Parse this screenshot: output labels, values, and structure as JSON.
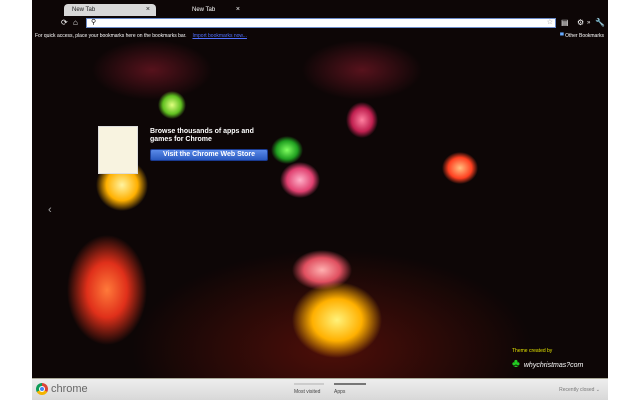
{
  "tabs": [
    {
      "label": "New Tab",
      "close": "×"
    },
    {
      "label": "New Tab",
      "close": "×"
    }
  ],
  "toolbar": {
    "search_value": "",
    "icons": [
      "reload-icon",
      "home-icon",
      "search-icon",
      "star-icon",
      "page-icon",
      "gear-icon",
      "wrench-icon"
    ]
  },
  "bookmarks": {
    "message": "For quick access, place your bookmarks here on the bookmarks bar.",
    "import_link": "Import bookmarks now...",
    "other": "Other Bookmarks"
  },
  "promo": {
    "text": "Browse thousands of apps and games for Chrome",
    "button": "Visit the Chrome Web Store"
  },
  "nav": {
    "prev": "‹"
  },
  "credit": {
    "label": "Theme created by",
    "site": "whychristmas?com"
  },
  "footer": {
    "brand": "chrome",
    "tabs": [
      "Most visited",
      "Apps"
    ],
    "recently_closed": "Recently closed ⌄"
  }
}
